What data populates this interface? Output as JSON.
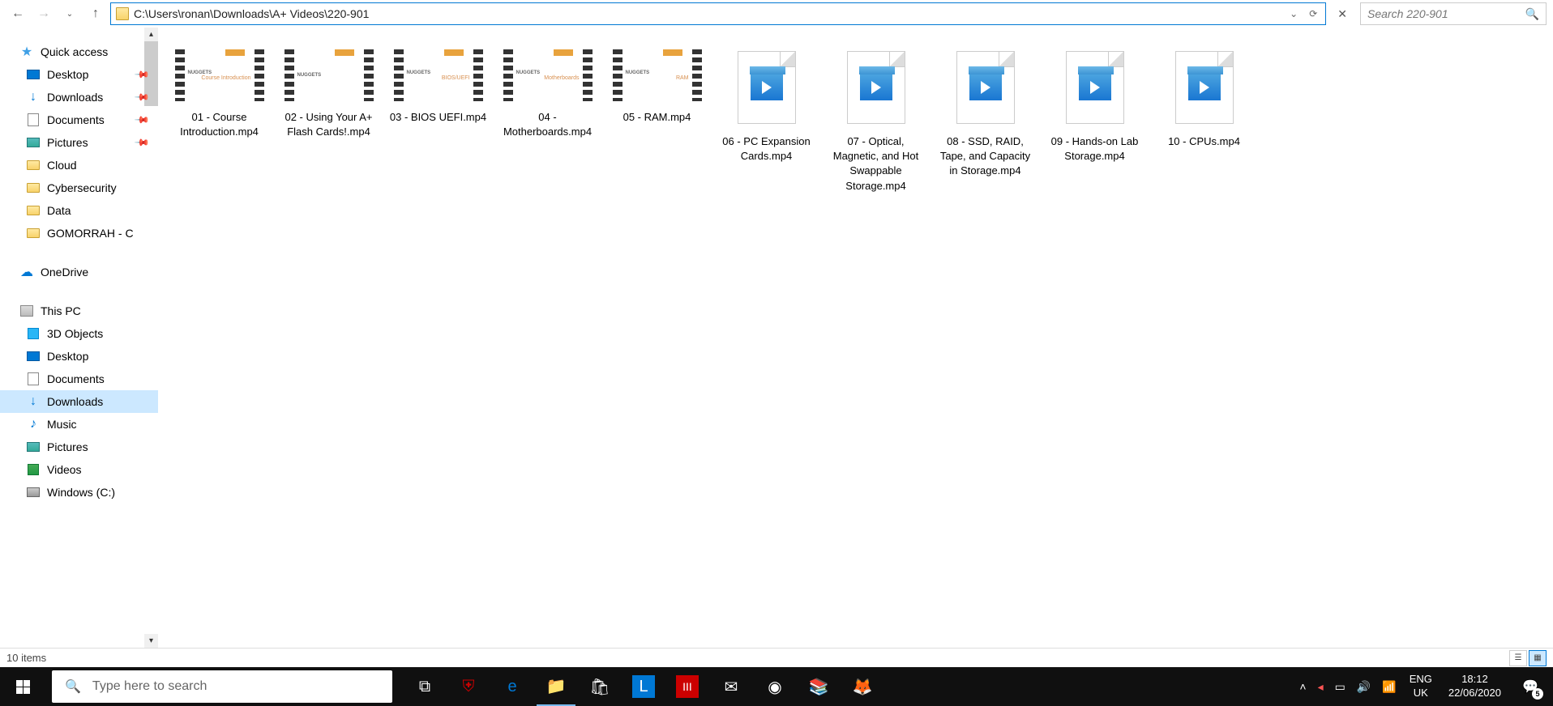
{
  "address": {
    "path": "C:\\Users\\ronan\\Downloads\\A+ Videos\\220-901"
  },
  "search": {
    "placeholder": "Search 220-901"
  },
  "sidebar": {
    "quick_access": {
      "label": "Quick access",
      "items": [
        {
          "label": "Desktop",
          "pinned": true
        },
        {
          "label": "Downloads",
          "pinned": true
        },
        {
          "label": "Documents",
          "pinned": true
        },
        {
          "label": "Pictures",
          "pinned": true
        },
        {
          "label": "Cloud",
          "pinned": false
        },
        {
          "label": "Cybersecurity",
          "pinned": false
        },
        {
          "label": "Data",
          "pinned": false
        },
        {
          "label": "GOMORRAH - C",
          "pinned": false
        }
      ]
    },
    "onedrive": {
      "label": "OneDrive"
    },
    "this_pc": {
      "label": "This PC",
      "items": [
        {
          "label": "3D Objects"
        },
        {
          "label": "Desktop"
        },
        {
          "label": "Documents"
        },
        {
          "label": "Downloads"
        },
        {
          "label": "Music"
        },
        {
          "label": "Pictures"
        },
        {
          "label": "Videos"
        },
        {
          "label": "Windows (C:)"
        }
      ]
    }
  },
  "files": [
    {
      "name": "01 - Course Introduction.mp4",
      "thumb_text": "Course Introduction",
      "has_thumb": true
    },
    {
      "name": "02 - Using Your A+ Flash Cards!.mp4",
      "thumb_text": "",
      "has_thumb": true
    },
    {
      "name": "03 - BIOS UEFI.mp4",
      "thumb_text": "BIOS/UEFI",
      "has_thumb": true
    },
    {
      "name": "04 - Motherboards.mp4",
      "thumb_text": "Motherboards",
      "has_thumb": true
    },
    {
      "name": "05 - RAM.mp4",
      "thumb_text": "RAM",
      "has_thumb": true
    },
    {
      "name": "06 - PC Expansion Cards.mp4",
      "thumb_text": "",
      "has_thumb": false
    },
    {
      "name": "07 - Optical, Magnetic, and Hot Swappable Storage.mp4",
      "thumb_text": "",
      "has_thumb": false
    },
    {
      "name": "08 - SSD, RAID, Tape, and Capacity in Storage.mp4",
      "thumb_text": "",
      "has_thumb": false
    },
    {
      "name": "09 - Hands-on Lab Storage.mp4",
      "thumb_text": "",
      "has_thumb": false
    },
    {
      "name": "10 - CPUs.mp4",
      "thumb_text": "",
      "has_thumb": false
    }
  ],
  "status": {
    "item_count": "10 items"
  },
  "taskbar": {
    "search_placeholder": "Type here to search",
    "lang1": "ENG",
    "lang2": "UK",
    "time": "18:12",
    "date": "22/06/2020",
    "notif_count": "5"
  },
  "nugget_label": "NUGGETS"
}
